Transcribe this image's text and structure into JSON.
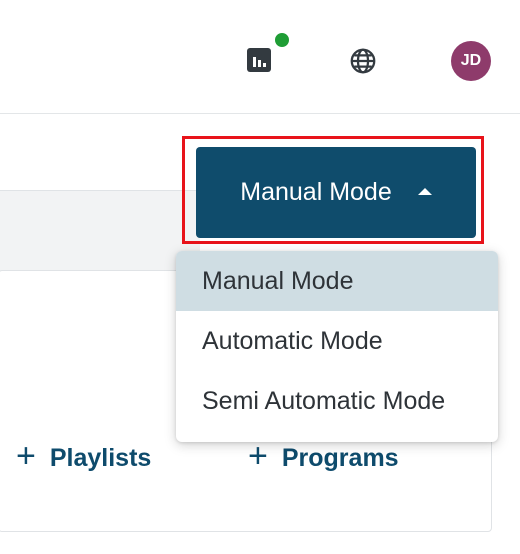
{
  "header": {
    "avatar_initials": "JD",
    "notification_status_color": "#1f9d35",
    "icons": [
      "analytics-icon",
      "globe-icon"
    ]
  },
  "mode_selector": {
    "current_label": "Manual Mode",
    "options": [
      {
        "label": "Manual Mode",
        "selected": true
      },
      {
        "label": "Automatic Mode",
        "selected": false
      },
      {
        "label": "Semi Automatic Mode",
        "selected": false
      }
    ]
  },
  "actions": {
    "playlists_label": "Playlists",
    "programs_label": "Programs"
  },
  "colors": {
    "primary": "#0f4c6c",
    "highlight": "#e8131a",
    "selected_bg": "#cfdde3",
    "avatar_bg": "#8e3b6b"
  }
}
